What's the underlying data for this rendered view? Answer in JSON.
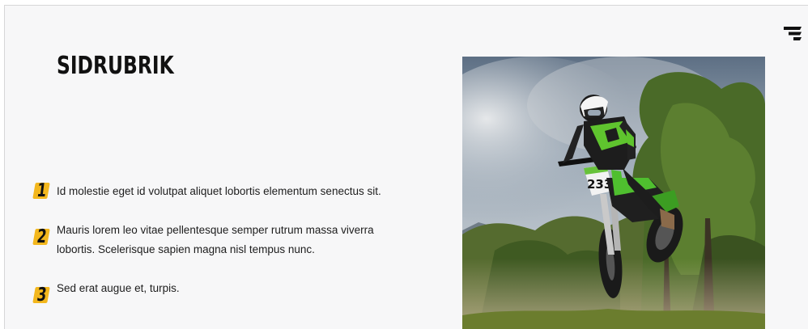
{
  "page": {
    "title": "SIDRUBRIK",
    "menu_icon": "hamburger-menu-icon"
  },
  "list": {
    "items": [
      {
        "number": "1",
        "text": "Id molestie eget id volutpat aliquet lobortis elementum senectus sit."
      },
      {
        "number": "2",
        "text": "Mauris lorem leo vitae pellentesque semper rutrum massa viverra lobortis. Scelerisque sapien magna nisl tempus nunc."
      },
      {
        "number": "3",
        "text": "Sed erat augue et, turpis."
      }
    ]
  },
  "image": {
    "subject": "motocross-rider-jump-photo",
    "bike_number": "233"
  },
  "colors": {
    "accent": "#f3b71d",
    "background": "#f7f7f8",
    "text": "#1d1d1d",
    "title": "#111111"
  }
}
